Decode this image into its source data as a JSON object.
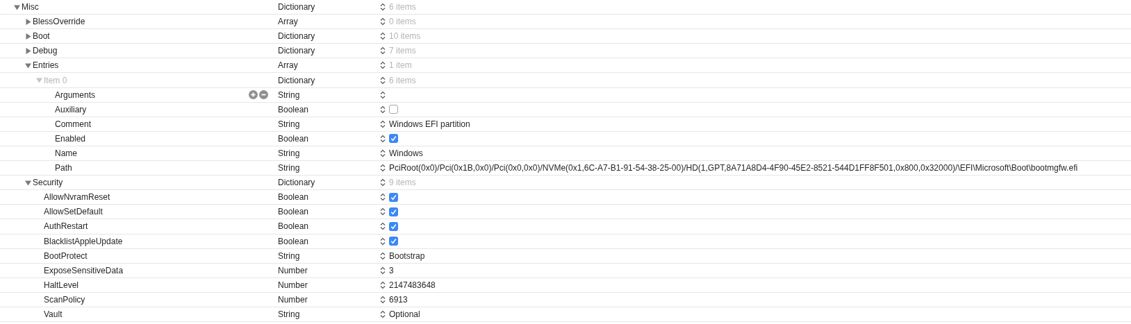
{
  "tree": [
    {
      "key": "Misc",
      "type": "Dictionary",
      "kind": "count",
      "value": "6 items",
      "expanded": true,
      "children": [
        {
          "key": "BlessOverride",
          "type": "Array",
          "kind": "count",
          "value": "0 items",
          "expanded": false
        },
        {
          "key": "Boot",
          "type": "Dictionary",
          "kind": "count",
          "value": "10 items",
          "expanded": false
        },
        {
          "key": "Debug",
          "type": "Dictionary",
          "kind": "count",
          "value": "7 items",
          "expanded": false
        },
        {
          "key": "Entries",
          "type": "Array",
          "kind": "count",
          "value": "1 item",
          "expanded": true,
          "children": [
            {
              "key": "Item 0",
              "type": "Dictionary",
              "kind": "count",
              "value": "6 items",
              "expanded": true,
              "dimmed": true,
              "children": [
                {
                  "key": "Arguments",
                  "type": "String",
                  "kind": "text",
                  "hovered": true
                },
                {
                  "key": "Auxiliary",
                  "type": "Boolean",
                  "kind": "boolean",
                  "checked": false
                },
                {
                  "key": "Comment",
                  "type": "String",
                  "kind": "text",
                  "value": "Windows EFI partition"
                },
                {
                  "key": "Enabled",
                  "type": "Boolean",
                  "kind": "boolean",
                  "checked": true
                },
                {
                  "key": "Name",
                  "type": "String",
                  "kind": "text",
                  "value": "Windows"
                },
                {
                  "key": "Path",
                  "type": "String",
                  "kind": "text",
                  "value": "PciRoot(0x0)/Pci(0x1B,0x0)/Pci(0x0,0x0)/NVMe(0x1,6C-A7-B1-91-54-38-25-00)/HD(1,GPT,8A71A8D4-4F90-45E2-8521-544D1FF8F501,0x800,0x32000)/\\EFI\\Microsoft\\Boot\\bootmgfw.efi"
                }
              ]
            }
          ]
        },
        {
          "key": "Security",
          "type": "Dictionary",
          "kind": "count",
          "value": "9 items",
          "expanded": true,
          "children": [
            {
              "key": "AllowNvramReset",
              "type": "Boolean",
              "kind": "boolean",
              "checked": true
            },
            {
              "key": "AllowSetDefault",
              "type": "Boolean",
              "kind": "boolean",
              "checked": true
            },
            {
              "key": "AuthRestart",
              "type": "Boolean",
              "kind": "boolean",
              "checked": true
            },
            {
              "key": "BlacklistAppleUpdate",
              "type": "Boolean",
              "kind": "boolean",
              "checked": true
            },
            {
              "key": "BootProtect",
              "type": "String",
              "kind": "text",
              "value": "Bootstrap"
            },
            {
              "key": "ExposeSensitiveData",
              "type": "Number",
              "kind": "text",
              "value": "3"
            },
            {
              "key": "HaltLevel",
              "type": "Number",
              "kind": "text",
              "value": "2147483648"
            },
            {
              "key": "ScanPolicy",
              "type": "Number",
              "kind": "text",
              "value": "6913"
            },
            {
              "key": "Vault",
              "type": "String",
              "kind": "text",
              "value": "Optional"
            }
          ]
        }
      ]
    }
  ]
}
